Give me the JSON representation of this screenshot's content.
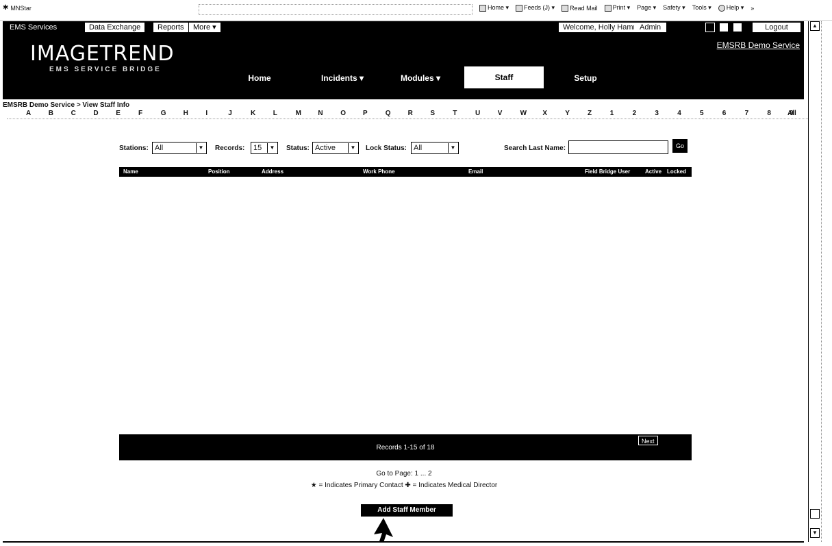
{
  "browser": {
    "title": "MNStar",
    "commands": [
      {
        "label": "Home ▾",
        "icon": "home-icon"
      },
      {
        "label": "Feeds (J) ▾",
        "icon": "rss-icon"
      },
      {
        "label": "Read Mail",
        "icon": "mail-icon"
      },
      {
        "label": "Print ▾",
        "icon": "printer-icon"
      },
      {
        "label": "Page ▾",
        "icon": ""
      },
      {
        "label": "Safety ▾",
        "icon": ""
      },
      {
        "label": "Tools ▾",
        "icon": ""
      },
      {
        "label": "Help ▾",
        "icon": "help-icon"
      }
    ],
    "overflow": "»"
  },
  "topbar": {
    "tabs": [
      "EMS Services",
      "Data Exchange",
      "Reports",
      "More ▾"
    ],
    "welcome": "Welcome, Holly Hammann",
    "admin": "Admin",
    "logout": "Logout"
  },
  "header": {
    "logo_main": "IMAGETREND",
    "logo_sub": "EMS SERVICE BRIDGE",
    "service_link": "EMSRB Demo Service",
    "nav": [
      "Home",
      "Incidents ▾",
      "Modules ▾",
      "Staff",
      "Setup"
    ],
    "active_nav": "Staff"
  },
  "breadcrumb": "EMSRB Demo Service > View Staff Info",
  "alphabet": [
    "A",
    "B",
    "C",
    "D",
    "E",
    "F",
    "G",
    "H",
    "I",
    "J",
    "K",
    "L",
    "M",
    "N",
    "O",
    "P",
    "Q",
    "R",
    "S",
    "T",
    "U",
    "V",
    "W",
    "X",
    "Y",
    "Z",
    "1",
    "2",
    "3",
    "4",
    "5",
    "6",
    "7",
    "8",
    "9",
    "All"
  ],
  "filters": {
    "stations_label": "Stations:",
    "stations_value": "All",
    "records_label": "Records:",
    "records_value": "15",
    "status_label": "Status:",
    "status_value": "Active",
    "lock_label": "Lock Status:",
    "lock_value": "All",
    "search_label": "Search Last Name:",
    "search_value": "",
    "go": "Go"
  },
  "table": {
    "columns": [
      "Name",
      "Position",
      "Address",
      "Work Phone",
      "Email",
      "Field Bridge User",
      "Active",
      "Locked"
    ]
  },
  "footer": {
    "records": "Records 1-15 of 18",
    "next": "Next",
    "goto": "Go to Page: 1 ... 2",
    "legend": "★ = Indicates Primary Contact  ✚ = Indicates Medical Director",
    "add_button": "Add Staff Member"
  }
}
